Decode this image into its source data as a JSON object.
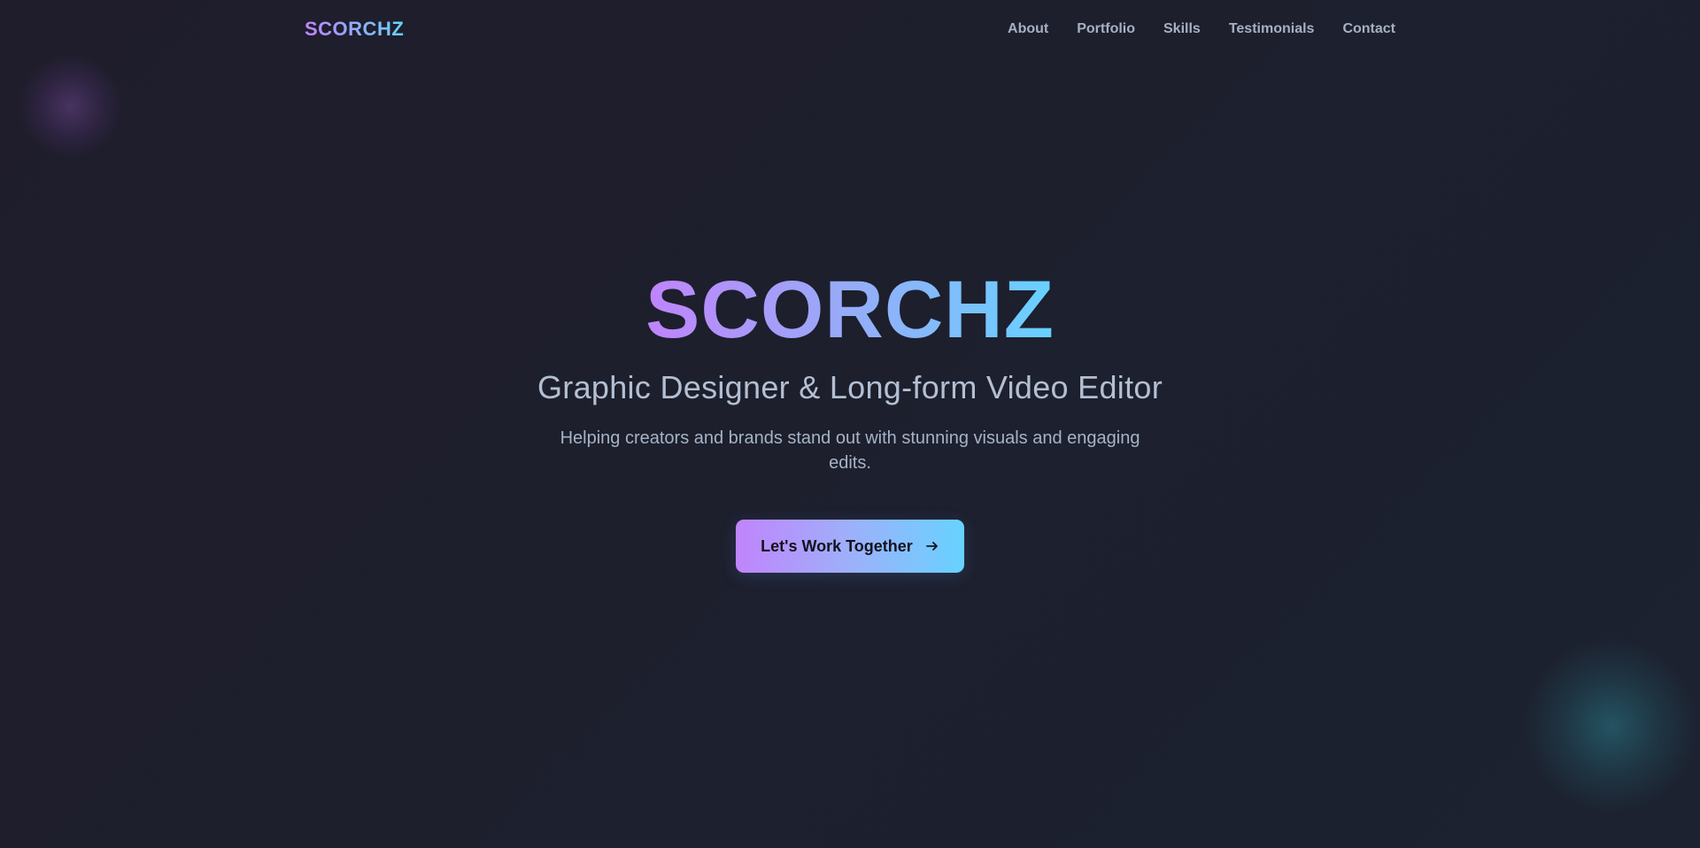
{
  "nav": {
    "logo": "SCORCHZ",
    "links": [
      "About",
      "Portfolio",
      "Skills",
      "Testimonials",
      "Contact"
    ]
  },
  "hero": {
    "title": "SCORCHZ",
    "subtitle": "Graphic Designer & Long-form Video Editor",
    "tagline": "Helping creators and brands stand out with stunning visuals and engaging edits.",
    "cta_label": "Let's Work Together",
    "cta_icon": "arrow-right-icon"
  },
  "colors": {
    "background": "#1e1f2c",
    "gradient_start": "#c084fc",
    "gradient_end": "#67d2ff",
    "nav_text": "#a7b0c2",
    "subtitle_text": "#b3bfd2"
  }
}
